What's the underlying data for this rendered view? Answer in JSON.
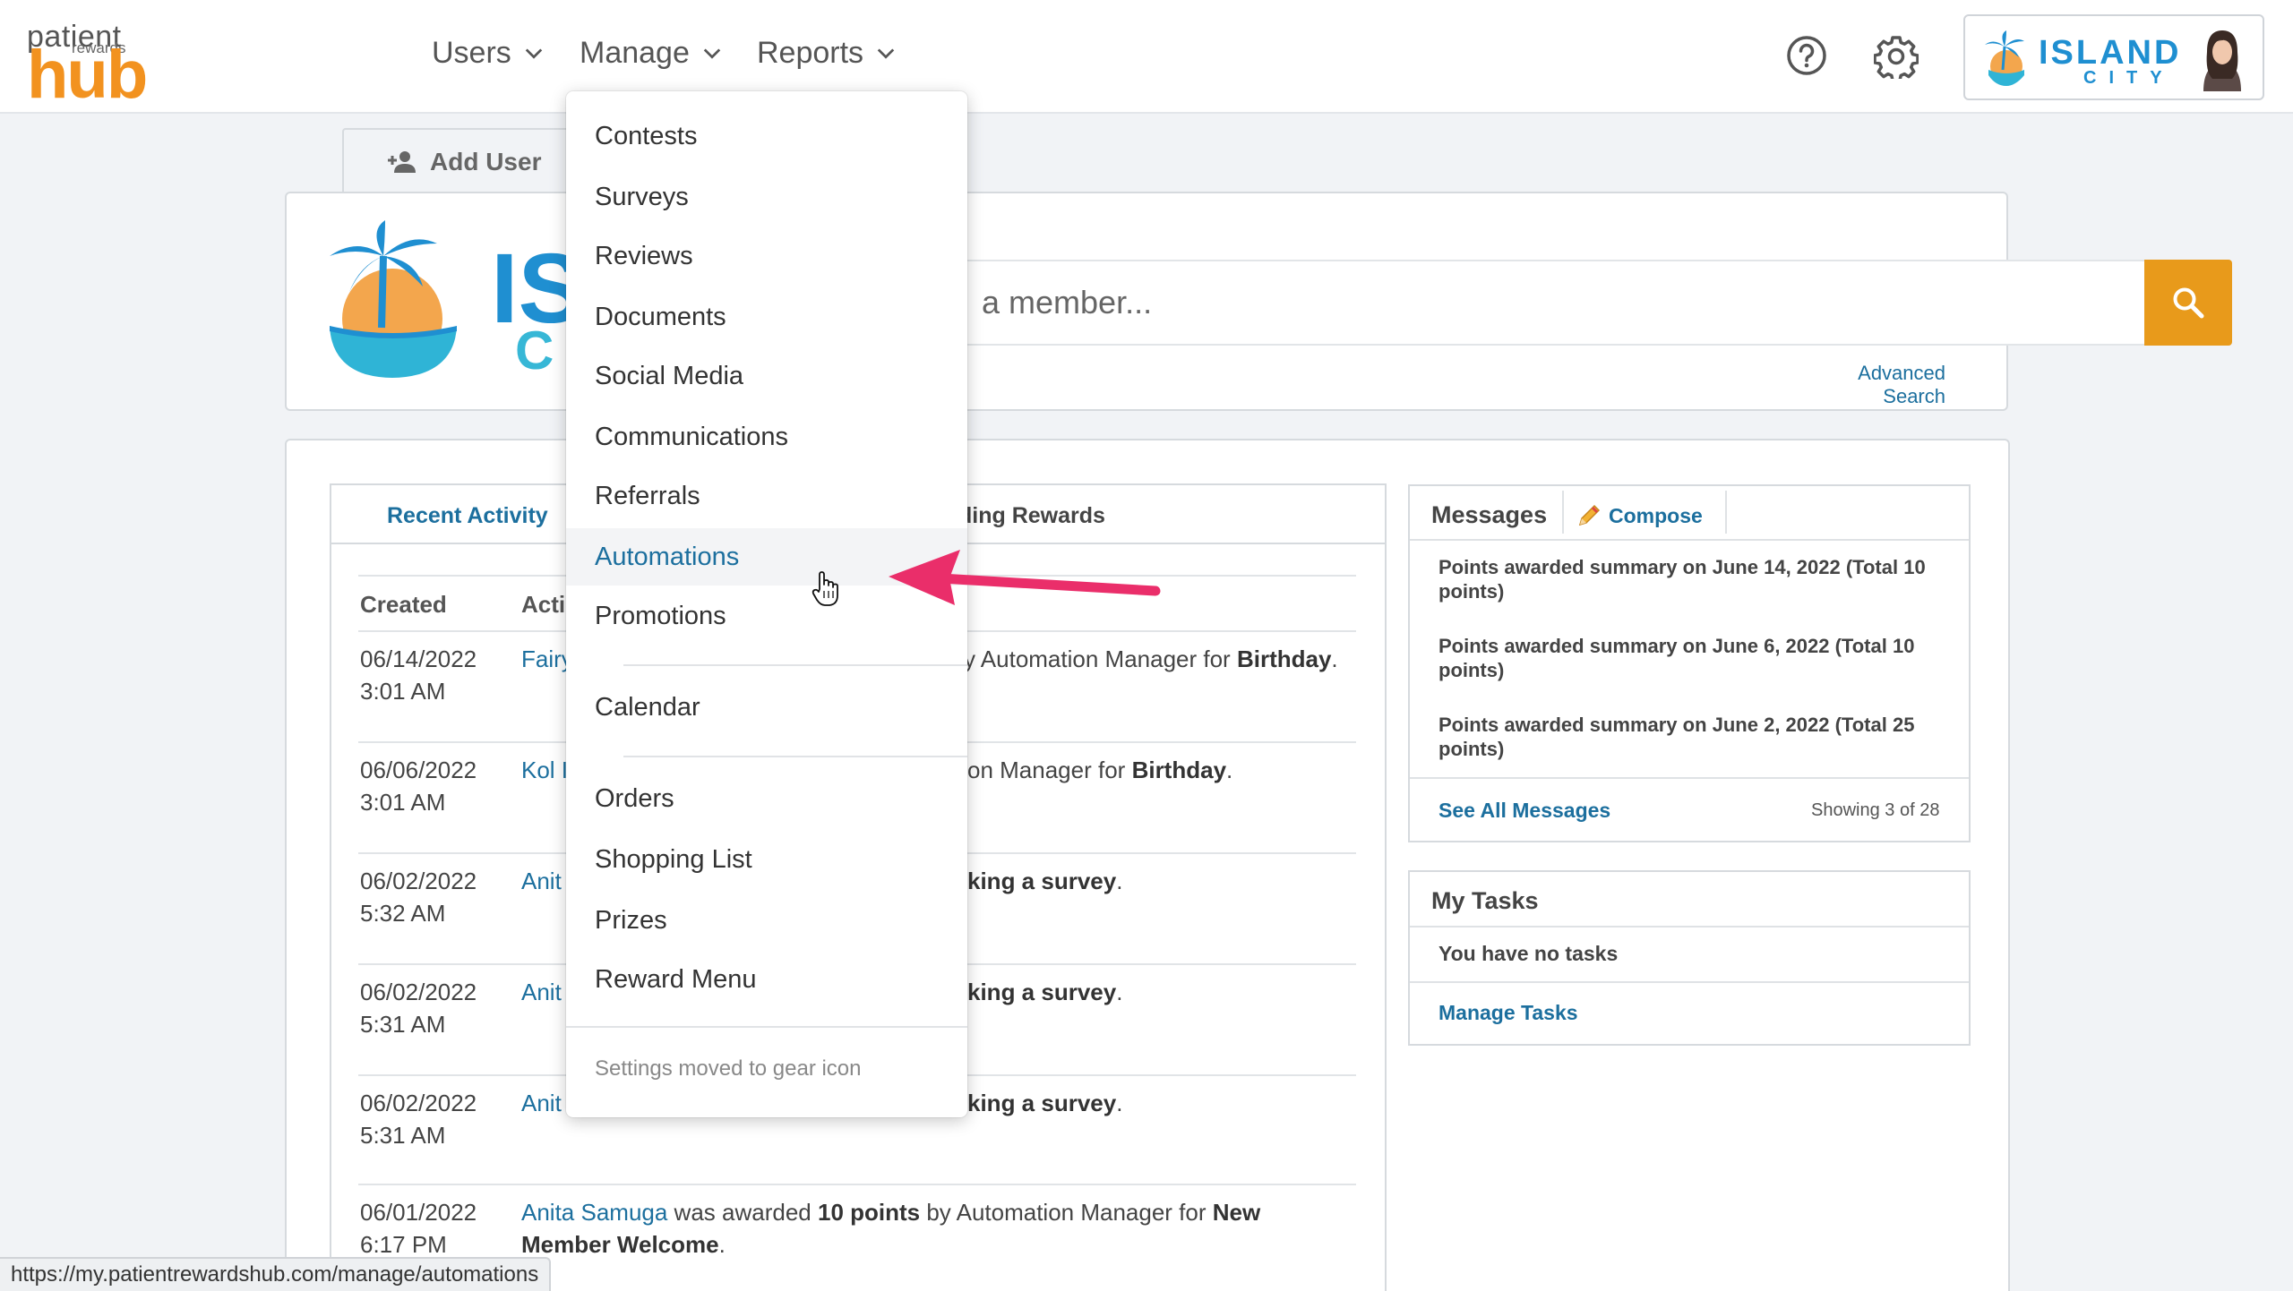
{
  "brand": {
    "logo_line1": "patient",
    "logo_line2": "rewards",
    "logo_line3": "hub",
    "accent": "#f2921f",
    "link_color": "#1c6f9e"
  },
  "nav": {
    "users": "Users",
    "manage": "Manage",
    "reports": "Reports"
  },
  "header": {
    "help_icon": "help-circle-icon",
    "gear_icon": "gear-icon",
    "org_name_line1": "ISLAND",
    "org_name_line2": "CITY"
  },
  "tabs": {
    "add_user": "Add User"
  },
  "search": {
    "logo_text1": "IS",
    "logo_text2": "C",
    "placeholder": "a member...",
    "advanced": "Advanced Search"
  },
  "activity": {
    "tab_recent": "Recent Activity",
    "tab_pending": "ding Rewards",
    "col_created": "Created",
    "col_activity": "Acti",
    "rows": [
      {
        "date": "06/14/2022",
        "time": "3:01 AM",
        "who": "Fairy",
        "text": "y Automation Manager for ",
        "bold": "Birthday",
        "end": "."
      },
      {
        "date": "06/06/2022",
        "time": "3:01 AM",
        "who": "Kol I",
        "text": "on Manager for ",
        "bold": "Birthday",
        "end": "."
      },
      {
        "date": "06/02/2022",
        "time": "5:32 AM",
        "who": "Anit",
        "text": "",
        "bold": "king a survey",
        "end": "."
      },
      {
        "date": "06/02/2022",
        "time": "5:31 AM",
        "who": "Anit",
        "text": "",
        "bold": "king a survey",
        "end": "."
      },
      {
        "date": "06/02/2022",
        "time": "5:31 AM",
        "who": "Anit",
        "text": "",
        "bold": "king a survey",
        "end": "."
      }
    ],
    "last_row": {
      "date": "06/01/2022",
      "time": "6:17 PM",
      "who": "Anita Samuga",
      "pre": " was awarded ",
      "points": "10 points",
      "mid": " by Automation Manager for ",
      "bold": "New Member Welcome",
      "end": "."
    }
  },
  "messages": {
    "title": "Messages",
    "compose": "Compose",
    "items": [
      "Points awarded summary on June 14, 2022 (Total 10 points)",
      "Points awarded summary on June 6, 2022 (Total 10 points)",
      "Points awarded summary on June 2, 2022 (Total 25 points)"
    ],
    "see_all": "See All Messages",
    "showing": "Showing 3 of 28"
  },
  "tasks": {
    "title": "My Tasks",
    "empty": "You have no tasks",
    "manage": "Manage Tasks"
  },
  "manage_menu": {
    "items": [
      "Contests",
      "Surveys",
      "Reviews",
      "Documents",
      "Social Media",
      "Communications",
      "Referrals",
      "Automations",
      "Promotions"
    ],
    "active": "Automations",
    "group2": [
      "Calendar"
    ],
    "group3": [
      "Orders",
      "Shopping List",
      "Prizes",
      "Reward Menu"
    ],
    "note": "Settings moved to gear icon"
  },
  "annotation": {
    "arrow_color": "#ea2e6a"
  },
  "statusbar": {
    "url": "https://my.patientrewardshub.com/manage/automations"
  }
}
